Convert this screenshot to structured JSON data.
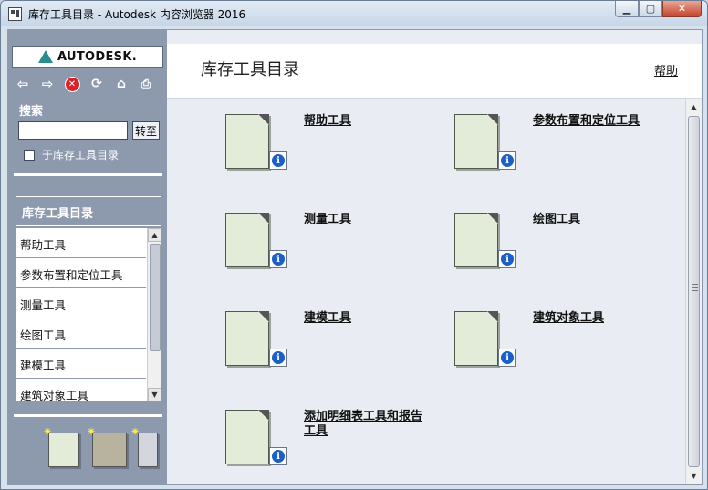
{
  "window": {
    "title": "库存工具目录 - Autodesk 内容浏览器 2016"
  },
  "logo": {
    "text": "AUTODESK."
  },
  "toolbar": {
    "icons": [
      "back-arrow-icon",
      "forward-arrow-icon",
      "stop-icon",
      "refresh-icon",
      "home-icon",
      "print-icon"
    ]
  },
  "search": {
    "label": "搜索",
    "value": "",
    "placeholder": "",
    "goto_label": "转至",
    "scope_label": "于库存工具目录",
    "scope_checked": false
  },
  "nav": {
    "header": "库存工具目录",
    "items": [
      "帮助工具",
      "参数布置和定位工具",
      "测量工具",
      "绘图工具",
      "建模工具",
      "建筑对象工具"
    ]
  },
  "main": {
    "title": "库存工具目录",
    "help_link": "帮助",
    "tools": [
      {
        "name": "帮助工具"
      },
      {
        "name": "参数布置和定位工具"
      },
      {
        "name": "测量工具"
      },
      {
        "name": "绘图工具"
      },
      {
        "name": "建模工具"
      },
      {
        "name": "建筑对象工具"
      },
      {
        "name": "添加明细表工具和报告工具"
      }
    ]
  },
  "colors": {
    "sidebar_bg": "#8d99ad",
    "content_bg": "#e9edf3",
    "doc_fill": "#e3ecd9",
    "info_blue": "#1b5fc7",
    "stop_red": "#d8232a"
  }
}
